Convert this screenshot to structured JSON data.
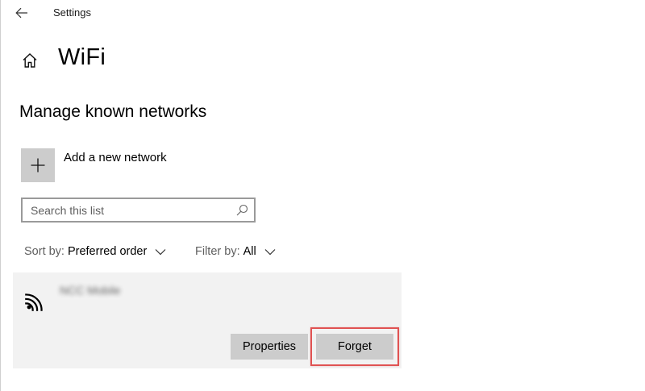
{
  "window": {
    "title": "Settings"
  },
  "header": {
    "page_title": "WiFi",
    "section_title": "Manage known networks"
  },
  "add_network": {
    "label": "Add a new network"
  },
  "search": {
    "placeholder": "Search this list",
    "value": ""
  },
  "sort": {
    "label": "Sort by:",
    "value": "Preferred order"
  },
  "filter": {
    "label": "Filter by:",
    "value": "All"
  },
  "networks": [
    {
      "name": "NCC Mobile",
      "properties_label": "Properties",
      "forget_label": "Forget"
    }
  ],
  "icons": {
    "back": "arrow-left-icon",
    "home": "home-icon",
    "add": "plus-icon",
    "search": "search-icon",
    "chevron": "chevron-down-icon",
    "wifi": "wifi-icon"
  },
  "colors": {
    "tile_gray": "#cccccc",
    "item_background": "#f2f2f2",
    "highlight_red": "#e05252",
    "secondary_text": "#5f5f5f"
  }
}
